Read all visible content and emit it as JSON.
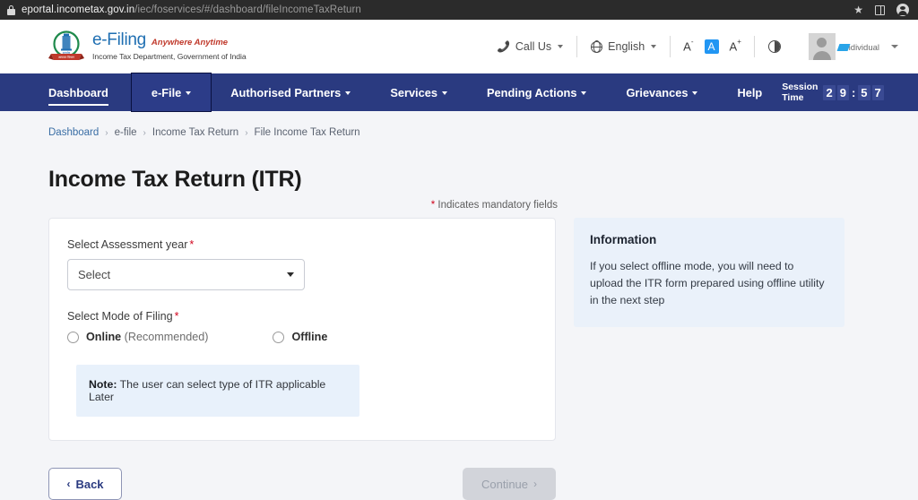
{
  "browser": {
    "lock_icon": "lock-icon",
    "url_host": "eportal.incometax.gov.in",
    "url_path": "/iec/foservices/#/dashboard/fileIncomeTaxReturn",
    "star_icon": "★",
    "panel_icon": "side-panel-icon",
    "profile_icon": "browser-profile-icon"
  },
  "header": {
    "brand": {
      "emblem_icon": "income-tax-department-emblem",
      "name": "e-Filing",
      "tagline": "Anywhere Anytime",
      "subtitle": "Income Tax Department, Government of India"
    },
    "tools": {
      "call_us": "Call Us",
      "phone_icon": "📞",
      "language": "English",
      "globe_icon": "globe-icon",
      "font_decrease": "A",
      "font_decrease_sup": "-",
      "font_normal": "A",
      "font_increase": "A",
      "font_increase_sup": "+",
      "contrast_icon": "contrast-icon",
      "active_font_bg": "#2196f3"
    },
    "user": {
      "name_redacted": "",
      "role": "Individual",
      "avatar_icon": "user-avatar-icon",
      "caret_icon": "chevron-down-icon"
    }
  },
  "nav": {
    "bg": "#2a3a80",
    "items": [
      {
        "label": "Dashboard",
        "has_caret": false,
        "active": true,
        "focused": false
      },
      {
        "label": "e-File",
        "has_caret": true,
        "active": false,
        "focused": true
      },
      {
        "label": "Authorised Partners",
        "has_caret": true,
        "active": false,
        "focused": false
      },
      {
        "label": "Services",
        "has_caret": true,
        "active": false,
        "focused": false
      },
      {
        "label": "Pending Actions",
        "has_caret": true,
        "active": false,
        "focused": false
      },
      {
        "label": "Grievances",
        "has_caret": true,
        "active": false,
        "focused": false
      },
      {
        "label": "Help",
        "has_caret": false,
        "active": false,
        "focused": false
      }
    ],
    "session": {
      "label": "Session Time",
      "d1": "2",
      "d2": "9",
      "colon": ":",
      "d3": "5",
      "d4": "7"
    }
  },
  "breadcrumb": {
    "items": [
      "Dashboard",
      "e-file",
      "Income Tax Return",
      "File Income Tax Return"
    ],
    "sep": "›"
  },
  "main": {
    "title": "Income Tax Return (ITR)",
    "mandatory_star": "*",
    "mandatory_text": " Indicates mandatory fields",
    "assessment_year": {
      "label": "Select Assessment year",
      "required_star": "*",
      "value": "Select",
      "caret_icon": "chevron-down-icon"
    },
    "mode_of_filing": {
      "label": "Select Mode of Filing",
      "required_star": "*",
      "options": [
        {
          "bold": "Online",
          "muted": " (Recommended)",
          "selected": false
        },
        {
          "bold": "Offline",
          "muted": "",
          "selected": false
        }
      ]
    },
    "note": {
      "prefix": "Note:",
      "text": " The user can select type of ITR applicable Later"
    }
  },
  "info_panel": {
    "title": "Information",
    "body": "If you select offline mode, you will need to upload the ITR form prepared using offline utility in the next step",
    "bg": "#eaf1fa"
  },
  "actions": {
    "back_label": "Back",
    "back_chevron": "‹",
    "continue_label": "Continue",
    "continue_chevron": "›",
    "continue_disabled": true
  }
}
